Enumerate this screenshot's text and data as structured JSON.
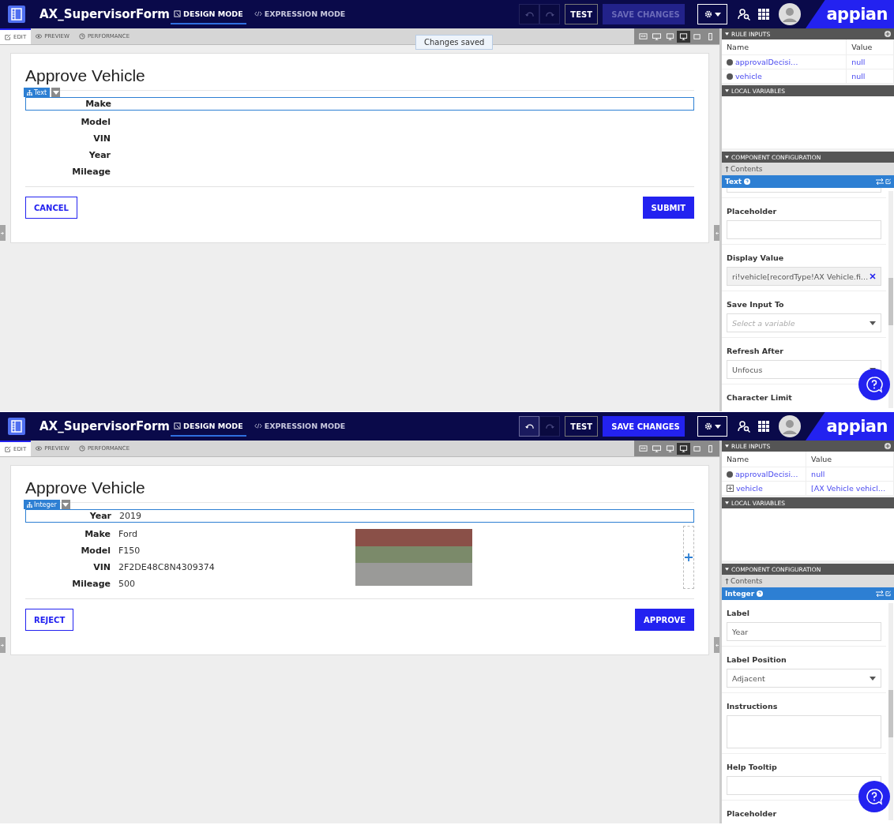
{
  "screens": [
    {
      "header": {
        "app_title": "AX_SupervisorForm",
        "modes": [
          {
            "label": "DESIGN MODE",
            "selected": true
          },
          {
            "label": "EXPRESSION MODE",
            "selected": false
          }
        ],
        "undo_disabled": true,
        "redo_disabled": true,
        "test_label": "TEST",
        "save_label": "SAVE CHANGES",
        "save_disabled": true,
        "logo": "appian"
      },
      "toast": "Changes saved",
      "view_tabs": [
        {
          "label": "EDIT",
          "kind": "edit",
          "selected": true
        },
        {
          "label": "PREVIEW",
          "kind": "preview",
          "selected": false
        },
        {
          "label": "PERFORMANCE",
          "kind": "performance",
          "selected": false
        }
      ],
      "devices": [
        {
          "kind": "fit",
          "selected": false
        },
        {
          "kind": "wide",
          "selected": false
        },
        {
          "kind": "desktop",
          "selected": false
        },
        {
          "kind": "desktop",
          "selected": true
        },
        {
          "kind": "tablet",
          "selected": false
        },
        {
          "kind": "phone",
          "selected": false
        }
      ],
      "form": {
        "title": "Approve Vehicle",
        "component_badge": "Text",
        "fields": [
          {
            "label": "Make",
            "selected": true
          },
          {
            "label": "Model",
            "selected": false
          },
          {
            "label": "VIN",
            "selected": false
          },
          {
            "label": "Year",
            "selected": false
          },
          {
            "label": "Mileage",
            "selected": false
          }
        ],
        "photo": false,
        "column_placeholder": false,
        "buttons": [
          {
            "label": "CANCEL",
            "kind": "secondary"
          },
          {
            "label": "SUBMIT",
            "kind": "primary"
          }
        ]
      },
      "rule_inputs": {
        "title": "RULE INPUTS",
        "columns": [
          "Name",
          "Value"
        ],
        "rows": [
          {
            "name": "approvalDecisi…",
            "value": "null",
            "kind": "leaf"
          },
          {
            "name": "vehicle",
            "value": "null",
            "kind": "leaf"
          }
        ]
      },
      "local_variables": {
        "title": "LOCAL VARIABLES"
      },
      "component_config": {
        "title": "COMPONENT CONFIGURATION",
        "breadcrumb": "Contents",
        "component": "Text",
        "properties": [
          {
            "kind": "cut"
          },
          {
            "kind": "text",
            "label": "Placeholder"
          },
          {
            "kind": "expression",
            "label": "Display Value",
            "value": "ri!vehicle[recordType!AX Vehicle.fi…"
          },
          {
            "kind": "select",
            "label": "Save Input To",
            "placeholder": "Select a variable"
          },
          {
            "kind": "select",
            "label": "Refresh After",
            "value": "Unfocus"
          },
          {
            "kind": "heading",
            "label": "Character Limit"
          }
        ]
      }
    },
    {
      "header": {
        "app_title": "AX_SupervisorForm",
        "modes": [
          {
            "label": "DESIGN MODE",
            "selected": true
          },
          {
            "label": "EXPRESSION MODE",
            "selected": false
          }
        ],
        "undo_disabled": false,
        "redo_disabled": true,
        "test_label": "TEST",
        "save_label": "SAVE CHANGES",
        "save_disabled": false,
        "logo": "appian"
      },
      "view_tabs": [
        {
          "label": "EDIT",
          "kind": "edit",
          "selected": true
        },
        {
          "label": "PREVIEW",
          "kind": "preview",
          "selected": false
        },
        {
          "label": "PERFORMANCE",
          "kind": "performance",
          "selected": false
        }
      ],
      "devices": [
        {
          "kind": "fit",
          "selected": false
        },
        {
          "kind": "wide",
          "selected": false
        },
        {
          "kind": "desktop",
          "selected": false
        },
        {
          "kind": "desktop",
          "selected": true
        },
        {
          "kind": "tablet",
          "selected": false
        },
        {
          "kind": "phone",
          "selected": false
        }
      ],
      "form": {
        "title": "Approve Vehicle",
        "component_badge": "Integer",
        "fields": [
          {
            "label": "Year",
            "value": "2019",
            "selected": true
          },
          {
            "label": "Make",
            "value": "Ford",
            "selected": false
          },
          {
            "label": "Model",
            "value": "F150",
            "selected": false
          },
          {
            "label": "VIN",
            "value": "2F2DE48C8N4309374",
            "selected": false
          },
          {
            "label": "Mileage",
            "value": "500",
            "selected": false
          }
        ],
        "photo": true,
        "column_placeholder": true,
        "buttons": [
          {
            "label": "REJECT",
            "kind": "secondary"
          },
          {
            "label": "APPROVE",
            "kind": "primary"
          }
        ]
      },
      "rule_inputs": {
        "title": "RULE INPUTS",
        "columns": [
          "Name",
          "Value"
        ],
        "rows": [
          {
            "name": "approvalDecisi…",
            "value": "null",
            "kind": "leaf"
          },
          {
            "name": "vehicle",
            "value": "[AX Vehicle vehicl…",
            "kind": "expandable"
          }
        ]
      },
      "local_variables": {
        "title": "LOCAL VARIABLES"
      },
      "component_config": {
        "title": "COMPONENT CONFIGURATION",
        "breadcrumb": "Contents",
        "component": "Integer",
        "properties": [
          {
            "kind": "text",
            "label": "Label",
            "value": "Year"
          },
          {
            "kind": "select",
            "label": "Label Position",
            "value": "Adjacent"
          },
          {
            "kind": "textarea",
            "label": "Instructions"
          },
          {
            "kind": "text",
            "label": "Help Tooltip"
          },
          {
            "kind": "heading",
            "label": "Placeholder"
          }
        ]
      }
    }
  ]
}
